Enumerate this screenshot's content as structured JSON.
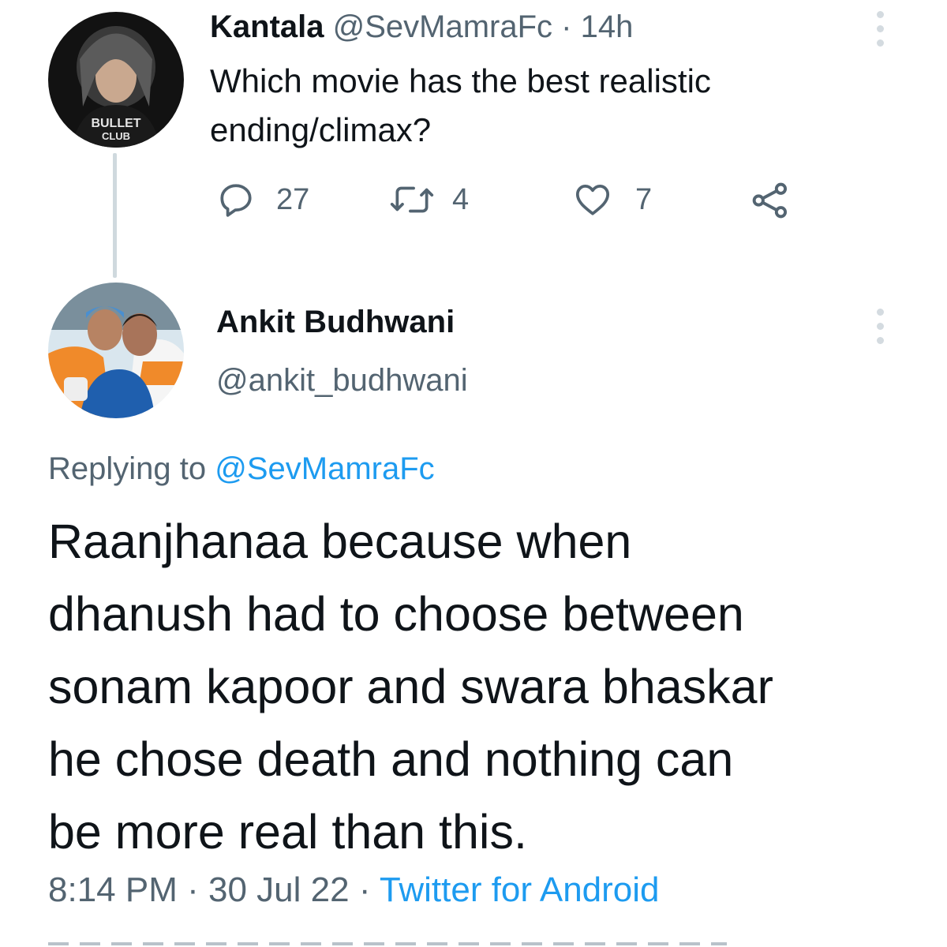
{
  "original_tweet": {
    "display_name": "Kantala",
    "handle": "@SevMamraFc",
    "separator": "·",
    "time": "14h",
    "text_line1": "Which movie has the best realistic",
    "text_line2": "ending/climax?",
    "avatar_caption_line1": "BULLET",
    "avatar_caption_line2": "CLUB",
    "actions": {
      "replies": "27",
      "retweets": "4",
      "likes": "7"
    }
  },
  "reply_tweet": {
    "display_name": "Ankit Budhwani",
    "handle": "@ankit_budhwani",
    "replying_prefix": "Replying to",
    "replying_handle": "@SevMamraFc",
    "text_lines": [
      "Raanjhanaa because when",
      "dhanush had to choose between",
      "sonam kapoor and swara bhaskar",
      "he chose death and nothing can",
      "be more real than this."
    ],
    "time": "8:14 PM",
    "sep1": "·",
    "date": "30 Jul 22",
    "sep2": "·",
    "source": "Twitter for Android"
  },
  "colors": {
    "text": "#0f1419",
    "secondary": "#536471",
    "link": "#1d9bf0",
    "thread_line": "#cfd9de"
  },
  "icons": [
    "reply-icon",
    "retweet-icon",
    "like-icon",
    "share-icon",
    "more-options-icon"
  ]
}
